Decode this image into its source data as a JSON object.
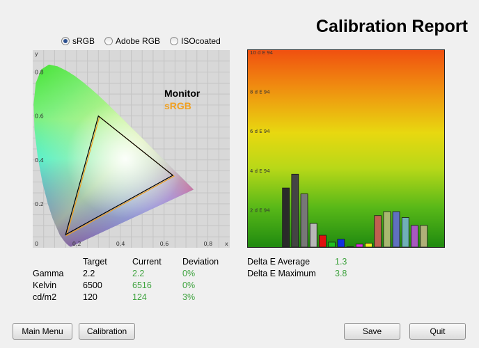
{
  "title": "Calibration Report",
  "color_spaces": {
    "options": [
      "sRGB",
      "Adobe RGB",
      "ISOcoated"
    ],
    "selected": "sRGB"
  },
  "gamut_chart": {
    "y_axis_label": "y",
    "x_axis_label": "x",
    "y_ticks": [
      "0.8",
      "0.6",
      "0.4",
      "0.2"
    ],
    "x_ticks": [
      "0",
      "0.2",
      "0.4",
      "0.6",
      "0.8"
    ],
    "legend": {
      "monitor": "Monitor",
      "srgb": "sRGB"
    },
    "colors": {
      "monitor": "#000000",
      "srgb": "#f0a020"
    },
    "monitor_triangle": [
      [
        0.64,
        0.33
      ],
      [
        0.3,
        0.6
      ],
      [
        0.15,
        0.06
      ]
    ],
    "srgb_triangle": [
      [
        0.64,
        0.33
      ],
      [
        0.3,
        0.6
      ],
      [
        0.15,
        0.06
      ]
    ]
  },
  "chart_data": {
    "type": "bar",
    "ylabel_ticks": [
      "10 d E 94",
      "8 d E 94",
      "6 d E 94",
      "4 d E 94",
      "2 d E 94"
    ],
    "ylim": [
      0,
      10
    ],
    "bars": [
      {
        "color": "#2a2a2a",
        "value": 3.0
      },
      {
        "color": "#444444",
        "value": 3.7
      },
      {
        "color": "#777777",
        "value": 2.7
      },
      {
        "color": "#b8b8b8",
        "value": 1.2
      },
      {
        "color": "#e01010",
        "value": 0.6
      },
      {
        "color": "#20c020",
        "value": 0.25
      },
      {
        "color": "#1030e0",
        "value": 0.4
      },
      {
        "color": "#20c8d8",
        "value": 0.0
      },
      {
        "color": "#e030e0",
        "value": 0.15
      },
      {
        "color": "#f0f020",
        "value": 0.2
      },
      {
        "color": "#c06050",
        "value": 1.6
      },
      {
        "color": "#a8b870",
        "value": 1.8
      },
      {
        "color": "#6070c0",
        "value": 1.8
      },
      {
        "color": "#70b0b8",
        "value": 1.5
      },
      {
        "color": "#a858c0",
        "value": 1.1
      },
      {
        "color": "#b0b078",
        "value": 1.1
      }
    ]
  },
  "stats": {
    "headers": [
      "Target",
      "Current",
      "Deviation"
    ],
    "rows": [
      {
        "label": "Gamma",
        "target": "2.2",
        "current": "2.2",
        "deviation": "0%"
      },
      {
        "label": "Kelvin",
        "target": "6500",
        "current": "6516",
        "deviation": "0%"
      },
      {
        "label": "cd/m2",
        "target": "120",
        "current": "124",
        "deviation": "3%"
      }
    ]
  },
  "delta": {
    "average_label": "Delta E Average",
    "average_value": "1.3",
    "maximum_label": "Delta E Maximum",
    "maximum_value": "3.8"
  },
  "buttons": {
    "main_menu": "Main Menu",
    "calibration": "Calibration",
    "save": "Save",
    "quit": "Quit"
  }
}
